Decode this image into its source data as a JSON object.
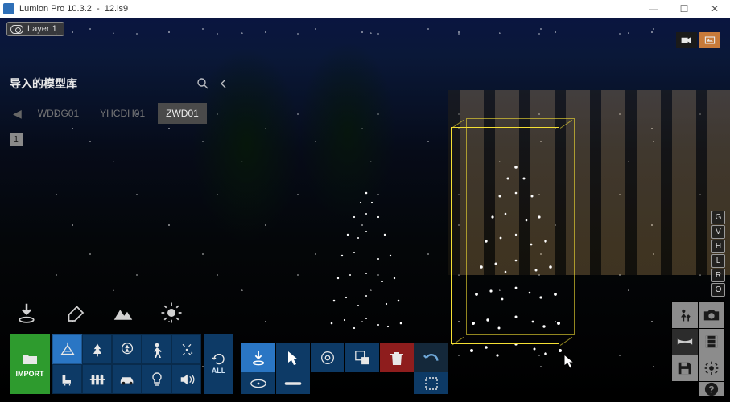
{
  "window": {
    "app": "Lumion Pro 10.3.2",
    "file": "12.ls9"
  },
  "wincontrols": {
    "min": "—",
    "max": "☐",
    "close": "✕"
  },
  "layer": {
    "label": "Layer 1"
  },
  "mode": {
    "camera": "camera-mode",
    "render": "render-mode",
    "active": 1
  },
  "library": {
    "title": "导入的模型库",
    "tabs": [
      "WDDG01",
      "YHCDH01",
      "ZWD01"
    ],
    "activeTab": 2,
    "page": "1"
  },
  "editTools": [
    "place-object",
    "eraser",
    "terrain",
    "weather"
  ],
  "importBtn": {
    "label": "IMPORT"
  },
  "categories": [
    "nature-objects",
    "trees",
    "trees-alt",
    "people",
    "fx",
    "furniture",
    "fences",
    "vehicles",
    "lights",
    "sound"
  ],
  "categoryActive": 0,
  "allBtn": {
    "label": "ALL"
  },
  "placeTools": {
    "row1": [
      "place",
      "select",
      "rotate",
      "scale",
      "delete",
      "undo"
    ],
    "row1Active": 0,
    "row2": [
      "transform-free",
      "transform-axis",
      "",
      "marquee"
    ]
  },
  "keyHints": [
    "G",
    "V",
    "H",
    "L",
    "R",
    "O"
  ],
  "rightPanel": [
    "worker",
    "photo",
    "strip",
    "film",
    "save",
    "settings",
    "help"
  ]
}
